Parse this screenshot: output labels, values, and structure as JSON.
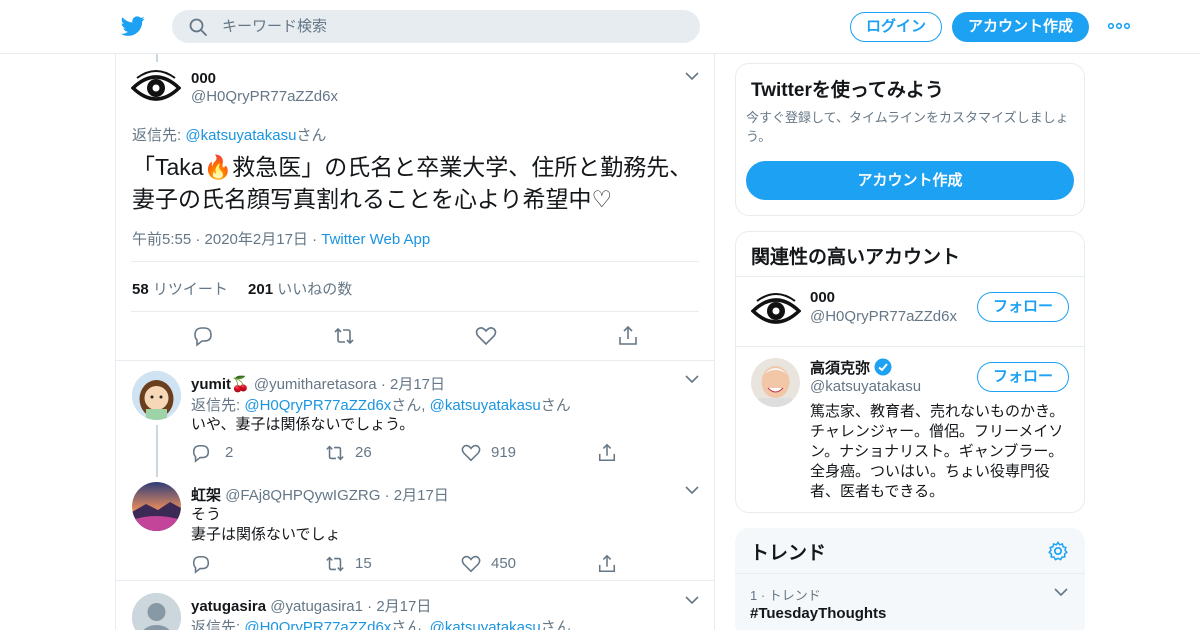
{
  "header": {
    "search_placeholder": "キーワード検索",
    "login_label": "ログイン",
    "signup_label": "アカウント作成",
    "brand_color": "#1da1f2"
  },
  "main_tweet": {
    "name": "000",
    "handle": "@H0QryPR77aZZd6x",
    "reply_prefix": "返信先: ",
    "reply_at": "@katsuyatakasu",
    "reply_suffix": "さん",
    "text_line1": "「Taka🔥救急医」の氏名と卒業大学、住所と勤務先、",
    "text_line2": "妻子の氏名顔写真割れることを心より希望中♡",
    "time": "午前5:55 · 2020年2月17日 · ",
    "source": "Twitter Web App",
    "retweet_count": "58",
    "retweet_label": "リツイート",
    "like_count": "201",
    "like_label": "いいねの数"
  },
  "replies": [
    {
      "name": "yumit🍒",
      "handle": "@yumitharetasora",
      "date": "2月17日",
      "reply_prefix": "返信先: ",
      "reply_at1": "@H0QryPR77aZZd6x",
      "reply_mid": "さん, ",
      "reply_at2": "@katsuyatakasu",
      "reply_suffix": "さん",
      "text1": "いや、妻子は関係ないでしょう。",
      "text2": "",
      "reply_count": "2",
      "retweet_count": "26",
      "like_count": "919"
    },
    {
      "name": "虹架",
      "handle": "@FAj8QHPQywIGZRG",
      "date": "2月17日",
      "text1": "そう",
      "text2": "妻子は関係ないでしょ",
      "reply_count": "",
      "retweet_count": "15",
      "like_count": "450"
    },
    {
      "name": "yatugasira",
      "handle": "@yatugasira1",
      "date": "2月17日",
      "reply_prefix": "返信先: ",
      "reply_at1": "@H0QryPR77aZZd6x",
      "reply_mid": "さん, ",
      "reply_at2": "@katsuyatakasu",
      "reply_suffix": "さん"
    }
  ],
  "sidebar": {
    "try_title": "Twitterを使ってみよう",
    "try_sub": "今すぐ登録して、タイムラインをカスタマイズしましょう。",
    "try_button": "アカウント作成",
    "related_title": "関連性の高いアカウント",
    "accounts": [
      {
        "name": "000",
        "handle": "@H0QryPR77aZZd6x",
        "follow": "フォロー"
      },
      {
        "name": "高須克弥",
        "handle": "@katsuyatakasu",
        "follow": "フォロー",
        "bio1": "篤志家、教育者、売れないものかき。",
        "bio2": "チャレンジャー。僧侶。フリーメイソ",
        "bio3": "ン。ナショナリスト。ギャンブラー。",
        "bio4": "全身癌。ついはい。ちょい役専門役",
        "bio5": "者、医者もできる。"
      }
    ],
    "trends_title": "トレンド",
    "trend_meta": "1 · トレンド",
    "trend_name": "#TuesdayThoughts"
  }
}
